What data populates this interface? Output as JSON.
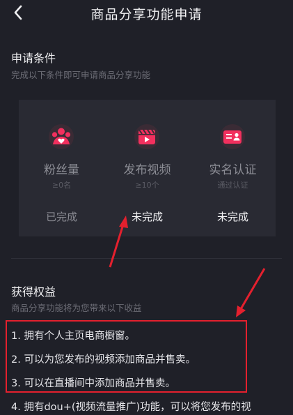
{
  "nav": {
    "title": "商品分享功能申请",
    "back_icon": "chevron-left-icon"
  },
  "conditions": {
    "title": "申请条件",
    "subtitle": "完成以下条件即可申请商品分享功能",
    "items": [
      {
        "icon": "fans-icon",
        "name": "粉丝量",
        "requirement": "≥0名",
        "status": "已完成",
        "complete": true
      },
      {
        "icon": "video-icon",
        "name": "发布视频",
        "requirement": "≥10个",
        "status": "未完成",
        "complete": false
      },
      {
        "icon": "id-card-icon",
        "name": "实名认证",
        "requirement": "通过认证",
        "status": "未完成",
        "complete": false
      }
    ]
  },
  "benefits": {
    "title": "获得权益",
    "subtitle": "商品分享功能将为您带来以下收益",
    "items": [
      "1. 拥有个人主页电商橱窗。",
      "2. 可以为您发布的视频添加商品并售卖。",
      "3. 可以在直播间中添加商品并售卖。",
      "4. 拥有dou+(视频流量推广)功能，可以将您发布的视"
    ]
  },
  "colors": {
    "accent": "#f2305e",
    "annotation": "#e4202e",
    "background": "#1f2028",
    "card": "#292a33"
  }
}
